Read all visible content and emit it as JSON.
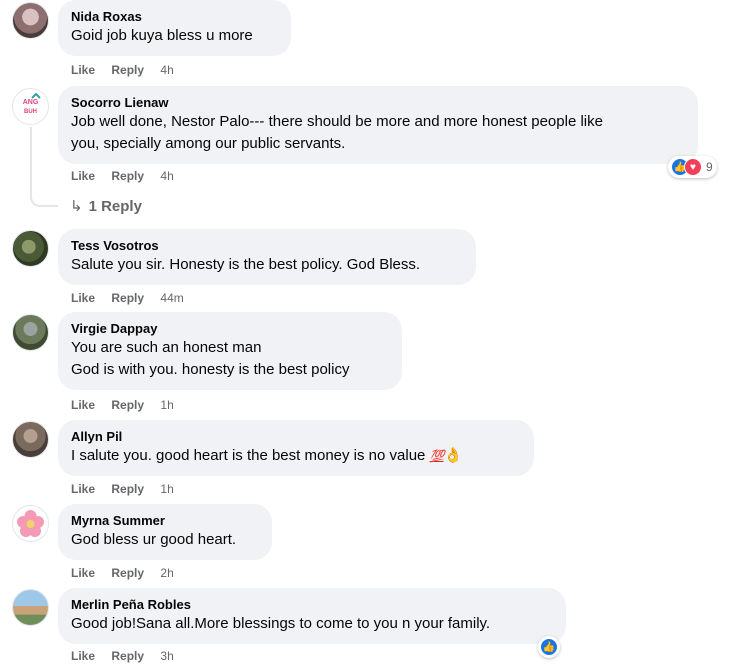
{
  "actions": {
    "like": "Like",
    "reply": "Reply"
  },
  "comments": [
    {
      "author": "Nida Roxas",
      "text": "Goid job kuya bless u more",
      "time": "4h"
    },
    {
      "author": "Socorro Lienaw",
      "text": "Job well done, Nestor Palo--- there should be more and more honest people like\nyou, specially among our public servants.",
      "time": "4h",
      "reactions_count": "9",
      "avatar_text": "ANGAT BUHAY"
    },
    {
      "author": "Tess Vosotros",
      "text": "Salute you sir. Honesty is the best policy. God Bless.",
      "time": "44m"
    },
    {
      "author": "Virgie Dappay",
      "text": "You are such an honest man\nGod is with you. honesty is the best policy",
      "time": "1h"
    },
    {
      "author": "Allyn Pil",
      "text": "I salute you. good heart is the best money is no value",
      "time": "1h",
      "emoji": "💯",
      "emoji2": "👌"
    },
    {
      "author": "Myrna Summer",
      "text": "God bless ur good heart.",
      "time": "2h"
    },
    {
      "author": "Merlin Peña Robles",
      "text": "Good job!Sana all.More blessings to come to you n your family.",
      "time": "3h"
    }
  ],
  "replies_link": "1 Reply"
}
